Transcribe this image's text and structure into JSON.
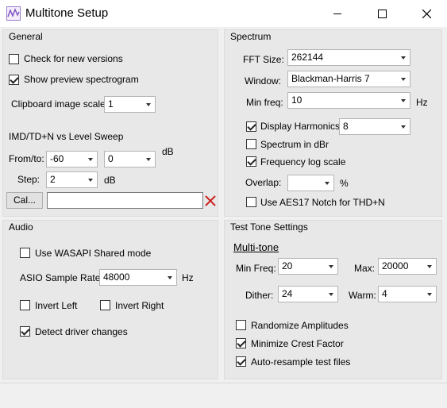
{
  "window": {
    "title": "Multitone Setup"
  },
  "general": {
    "title": "General",
    "check_versions": "Check for new versions",
    "show_preview": "Show preview spectrogram",
    "clipboard_scale_label": "Clipboard image scale:",
    "clipboard_scale_value": "1",
    "sweep_title": "IMD/TD+N vs Level Sweep",
    "from_to_label": "From/to:",
    "from_value": "-60",
    "to_value": "0",
    "db1": "dB",
    "step_label": "Step:",
    "step_value": "2",
    "db2": "dB",
    "cal_button": "Cal..."
  },
  "spectrum": {
    "title": "Spectrum",
    "fft_label": "FFT Size:",
    "fft_value": "262144",
    "window_label": "Window:",
    "window_value": "Blackman-Harris 7",
    "minfreq_label": "Min freq:",
    "minfreq_value": "10",
    "hz": "Hz",
    "display_harmonics": "Display Harmonics",
    "harmonics_value": "8",
    "spectrum_dbr": "Spectrum in dBr",
    "freq_log": "Frequency log scale",
    "overlap_label": "Overlap:",
    "overlap_value": "",
    "percent": "%",
    "aes17": "Use AES17 Notch for THD+N"
  },
  "audio": {
    "title": "Audio",
    "wasapi": "Use WASAPI Shared mode",
    "asio_label": "ASIO Sample Rate:",
    "asio_value": "48000",
    "hz": "Hz",
    "invert_left": "Invert Left",
    "invert_right": "Invert Right",
    "detect_driver": "Detect driver changes"
  },
  "test_tone": {
    "title": "Test Tone Settings",
    "multitone": "Multi-tone",
    "minfreq_label": "Min Freq:",
    "minfreq_value": "20",
    "max_label": "Max:",
    "max_value": "20000",
    "dither_label": "Dither:",
    "dither_value": "24",
    "warm_label": "Warm:",
    "warm_value": "4",
    "randomize": "Randomize Amplitudes",
    "minimize_crest": "Minimize Crest Factor",
    "auto_resample": "Auto-resample test files"
  },
  "colors": {
    "clear_x": "#cc2222",
    "accent": "#0078d7"
  }
}
